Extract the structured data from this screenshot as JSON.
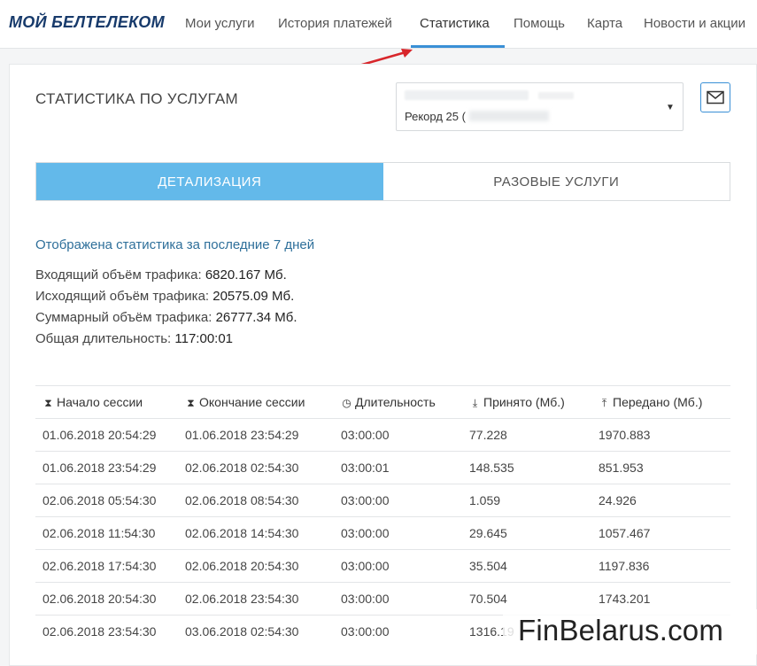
{
  "app": {
    "logo": "МОЙ БЕЛТЕЛЕКОМ"
  },
  "nav": {
    "items": [
      {
        "label": "Мои услуги"
      },
      {
        "label": "История платежей"
      },
      {
        "label": "Статистика"
      },
      {
        "label": "Помощь"
      },
      {
        "label": "Карта"
      },
      {
        "label": "Новости и акции"
      }
    ],
    "active_index": 2
  },
  "page": {
    "title": "СТАТИСТИКА ПО УСЛУГАМ"
  },
  "service_select": {
    "selected": "Рекорд 25 (",
    "caret_icon": "caret-down-icon"
  },
  "mail_button": {
    "icon": "envelope-icon"
  },
  "tabs": [
    {
      "label": "ДЕТАЛИЗАЦИЯ",
      "active": true
    },
    {
      "label": "РАЗОВЫЕ УСЛУГИ",
      "active": false
    }
  ],
  "summary": {
    "period": "Отображена статистика за последние 7 дней",
    "incoming_label": "Входящий объём трафика:",
    "incoming_value": "6820.167 Мб.",
    "outgoing_label": "Исходящий объём трафика:",
    "outgoing_value": "20575.09 Мб.",
    "total_label": "Суммарный объём трафика:",
    "total_value": "26777.34 Мб.",
    "duration_label": "Общая длительность:",
    "duration_value": "117:00:01"
  },
  "table": {
    "headers": [
      {
        "label": "Начало сессии",
        "icon": "hourglass-icon"
      },
      {
        "label": "Окончание сессии",
        "icon": "hourglass-end-icon"
      },
      {
        "label": "Длительность",
        "icon": "clock-icon"
      },
      {
        "label": "Принято (Мб.)",
        "icon": "download-icon"
      },
      {
        "label": "Передано (Мб.)",
        "icon": "upload-icon"
      }
    ],
    "rows": [
      [
        "01.06.2018 20:54:29",
        "01.06.2018 23:54:29",
        "03:00:00",
        "77.228",
        "1970.883"
      ],
      [
        "01.06.2018 23:54:29",
        "02.06.2018 02:54:30",
        "03:00:01",
        "148.535",
        "851.953"
      ],
      [
        "02.06.2018 05:54:30",
        "02.06.2018 08:54:30",
        "03:00:00",
        "1.059",
        "24.926"
      ],
      [
        "02.06.2018 11:54:30",
        "02.06.2018 14:54:30",
        "03:00:00",
        "29.645",
        "1057.467"
      ],
      [
        "02.06.2018 17:54:30",
        "02.06.2018 20:54:30",
        "03:00:00",
        "35.504",
        "1197.836"
      ],
      [
        "02.06.2018 20:54:30",
        "02.06.2018 23:54:30",
        "03:00:00",
        "70.504",
        "1743.201"
      ],
      [
        "02.06.2018 23:54:30",
        "03.06.2018 02:54:30",
        "03:00:00",
        "1316.19",
        ""
      ]
    ]
  },
  "watermark": {
    "text": "FinBelarus.com"
  },
  "colors": {
    "brand": "#173a6b",
    "accent": "#3a90d6",
    "tab_active": "#63b9ea",
    "annotation_arrow": "#d8262b"
  }
}
